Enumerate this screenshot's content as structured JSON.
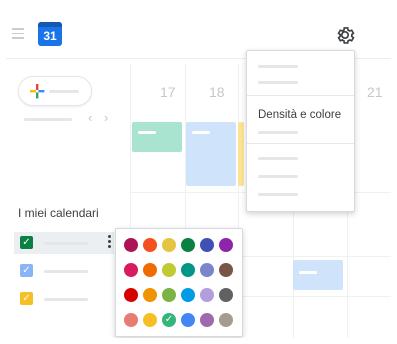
{
  "header": {
    "calendar_logo_day": "31",
    "menu_icon": "hamburger-menu-icon",
    "settings_icon": "gear-icon"
  },
  "week": {
    "days": [
      "17",
      "18",
      "21"
    ],
    "nav_prev": "‹",
    "nav_next": "›"
  },
  "sidebar": {
    "my_calendars_title": "I miei calendari",
    "calendars": [
      {
        "checked": true,
        "color": "#0b8043"
      },
      {
        "checked": true,
        "color": "#4285f4"
      },
      {
        "checked": true,
        "color": "#f6bf26"
      }
    ]
  },
  "settings_menu": {
    "density_and_color": "Densità e colore"
  },
  "color_picker": {
    "selected_mark": "✓",
    "rows": [
      [
        "#ad1457",
        "#f4511e",
        "#e4c441",
        "#0b8043",
        "#3f51b5",
        "#8e24aa"
      ],
      [
        "#d81b60",
        "#ef6c00",
        "#c0ca33",
        "#009688",
        "#7986cb",
        "#795548"
      ],
      [
        "#d50000",
        "#f09300",
        "#7cb342",
        "#039be5",
        "#b39ddb",
        "#616161"
      ],
      [
        "#e67c73",
        "#f6bf26",
        "#33b679",
        "#4285f4",
        "#9e69af",
        "#a79b8e"
      ]
    ],
    "selected": "#33b679"
  },
  "events_colors": {
    "green": "#a8e4cf",
    "blue": "#cfe3fb",
    "yellow": "#fde293"
  }
}
